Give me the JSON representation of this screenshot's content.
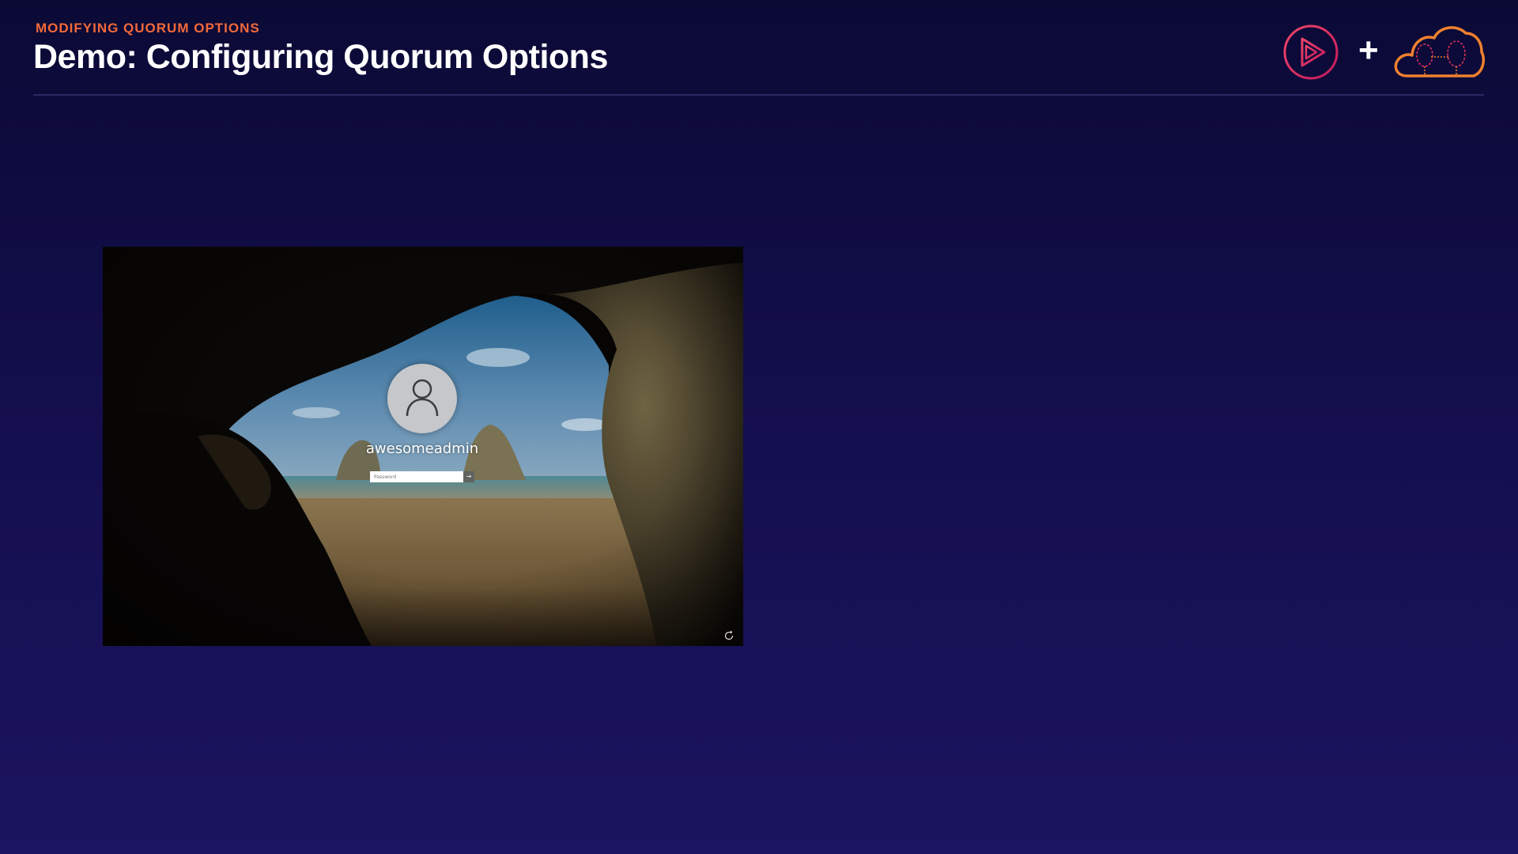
{
  "slide": {
    "eyebrow": "MODIFYING QUORUM OPTIONS",
    "title": "Demo: Configuring Quorum Options",
    "plus": "+"
  },
  "logos": {
    "left": "play-logo-icon",
    "right": "cloud-brain-logo-icon"
  },
  "colors": {
    "accent_orange": "#f26a3a",
    "accent_pink": "#e8335e",
    "background_top": "#0b0a35",
    "background_bottom": "#1b1460"
  },
  "lock_screen": {
    "username": "awesomeadmin",
    "password_placeholder": "Password",
    "submit_icon": "arrow-right-icon",
    "ease_of_access_icon": "ease-of-access-icon"
  }
}
